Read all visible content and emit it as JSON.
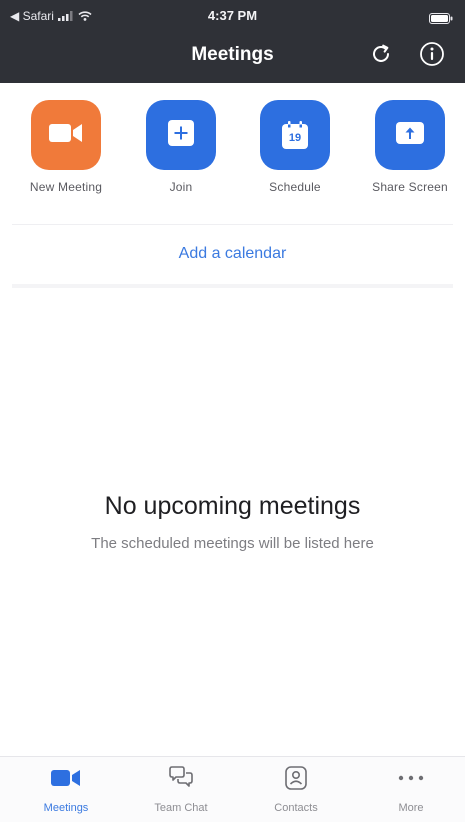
{
  "status_bar": {
    "back_label": "◀ Safari",
    "time": "4:37 PM"
  },
  "nav": {
    "title": "Meetings",
    "refresh_icon": "refresh-icon",
    "info_icon": "info-icon"
  },
  "actions": [
    {
      "label": "New Meeting",
      "icon": "video-camera-icon",
      "color": "#f07a3a"
    },
    {
      "label": "Join",
      "icon": "plus-icon",
      "color": "#2d6fe0"
    },
    {
      "label": "Schedule",
      "icon": "calendar-icon",
      "color": "#2d6fe0",
      "calendar_day": "19"
    },
    {
      "label": "Share Screen",
      "icon": "share-upload-icon",
      "color": "#2d6fe0"
    }
  ],
  "calendar_link": "Add a calendar",
  "empty_state": {
    "title": "No upcoming meetings",
    "subtitle": "The scheduled meetings will be listed here"
  },
  "tabs": [
    {
      "label": "Meetings",
      "icon": "video-camera-icon",
      "active": true
    },
    {
      "label": "Team Chat",
      "icon": "chat-bubbles-icon",
      "active": false
    },
    {
      "label": "Contacts",
      "icon": "contacts-icon",
      "active": false
    },
    {
      "label": "More",
      "icon": "more-dots-icon",
      "active": false
    }
  ],
  "colors": {
    "header_bg": "#2f3137",
    "accent_blue": "#2d6fe0",
    "accent_orange": "#f07a3a",
    "link_blue": "#3b7ae0"
  }
}
